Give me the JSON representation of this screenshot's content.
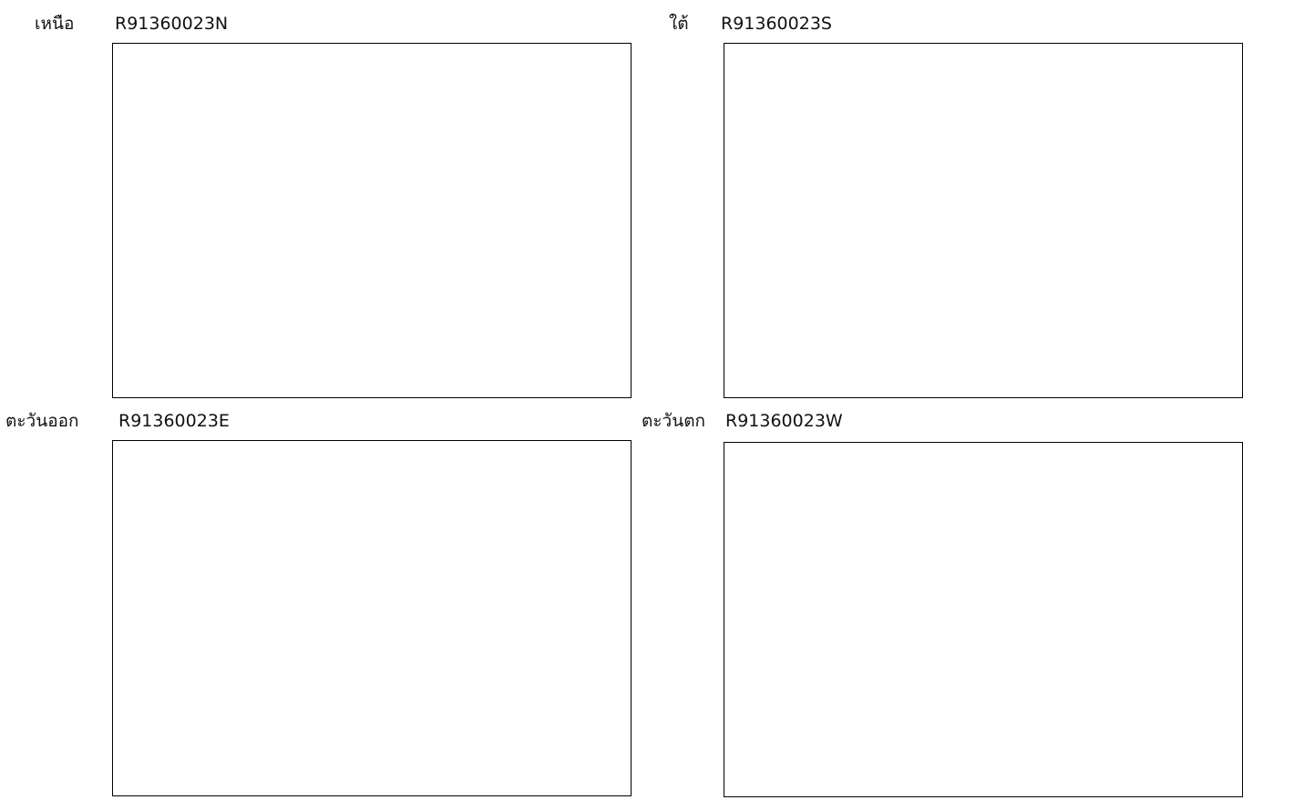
{
  "panels": {
    "north": {
      "direction": "เหนือ",
      "code": "R91360023N"
    },
    "south": {
      "direction": "ใต้",
      "code": "R91360023S"
    },
    "east": {
      "direction": "ตะวันออก",
      "code": "R91360023E"
    },
    "west": {
      "direction": "ตะวันตก",
      "code": "R91360023W"
    }
  }
}
